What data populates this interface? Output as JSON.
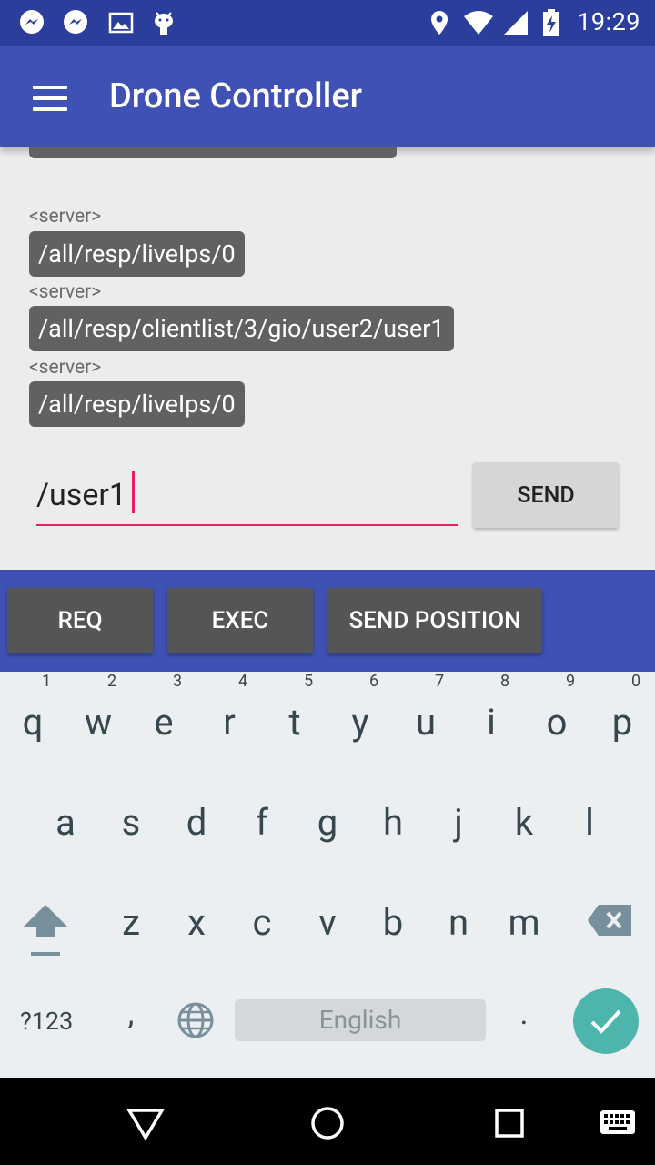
{
  "status_bar": {
    "time": "19:29",
    "icons": [
      "messenger-icon",
      "messenger-icon",
      "image-icon",
      "android-icon",
      "location-icon",
      "wifi-icon",
      "signal-icon",
      "battery-charging-icon"
    ]
  },
  "app_bar": {
    "title": "Drone Controller",
    "menu_icon": "hamburger-menu-icon"
  },
  "messages": [
    {
      "sender": "<server>",
      "text": "/all/resp/liveIps/0"
    },
    {
      "sender": "<server>",
      "text": "/all/resp/clientlist/3/gio/user2/user1"
    },
    {
      "sender": "<server>",
      "text": "/all/resp/liveIps/0"
    }
  ],
  "input": {
    "value": "/user1",
    "send_label": "SEND"
  },
  "actions": {
    "req_label": "REQ",
    "exec_label": "EXEC",
    "send_position_label": "SEND POSITION"
  },
  "keyboard": {
    "row1": [
      "q",
      "w",
      "e",
      "r",
      "t",
      "y",
      "u",
      "i",
      "o",
      "p"
    ],
    "row1_hints": [
      "1",
      "2",
      "3",
      "4",
      "5",
      "6",
      "7",
      "8",
      "9",
      "0"
    ],
    "row2": [
      "a",
      "s",
      "d",
      "f",
      "g",
      "h",
      "j",
      "k",
      "l"
    ],
    "row3": [
      "z",
      "x",
      "c",
      "v",
      "b",
      "n",
      "m"
    ],
    "symbols_label": "?123",
    "comma": ",",
    "period": ".",
    "space_label": "English"
  },
  "colors": {
    "primary": "#3f51b5",
    "primary_dark": "#2c3e9c",
    "accent": "#e91e63",
    "done_key": "#4db6ac"
  }
}
